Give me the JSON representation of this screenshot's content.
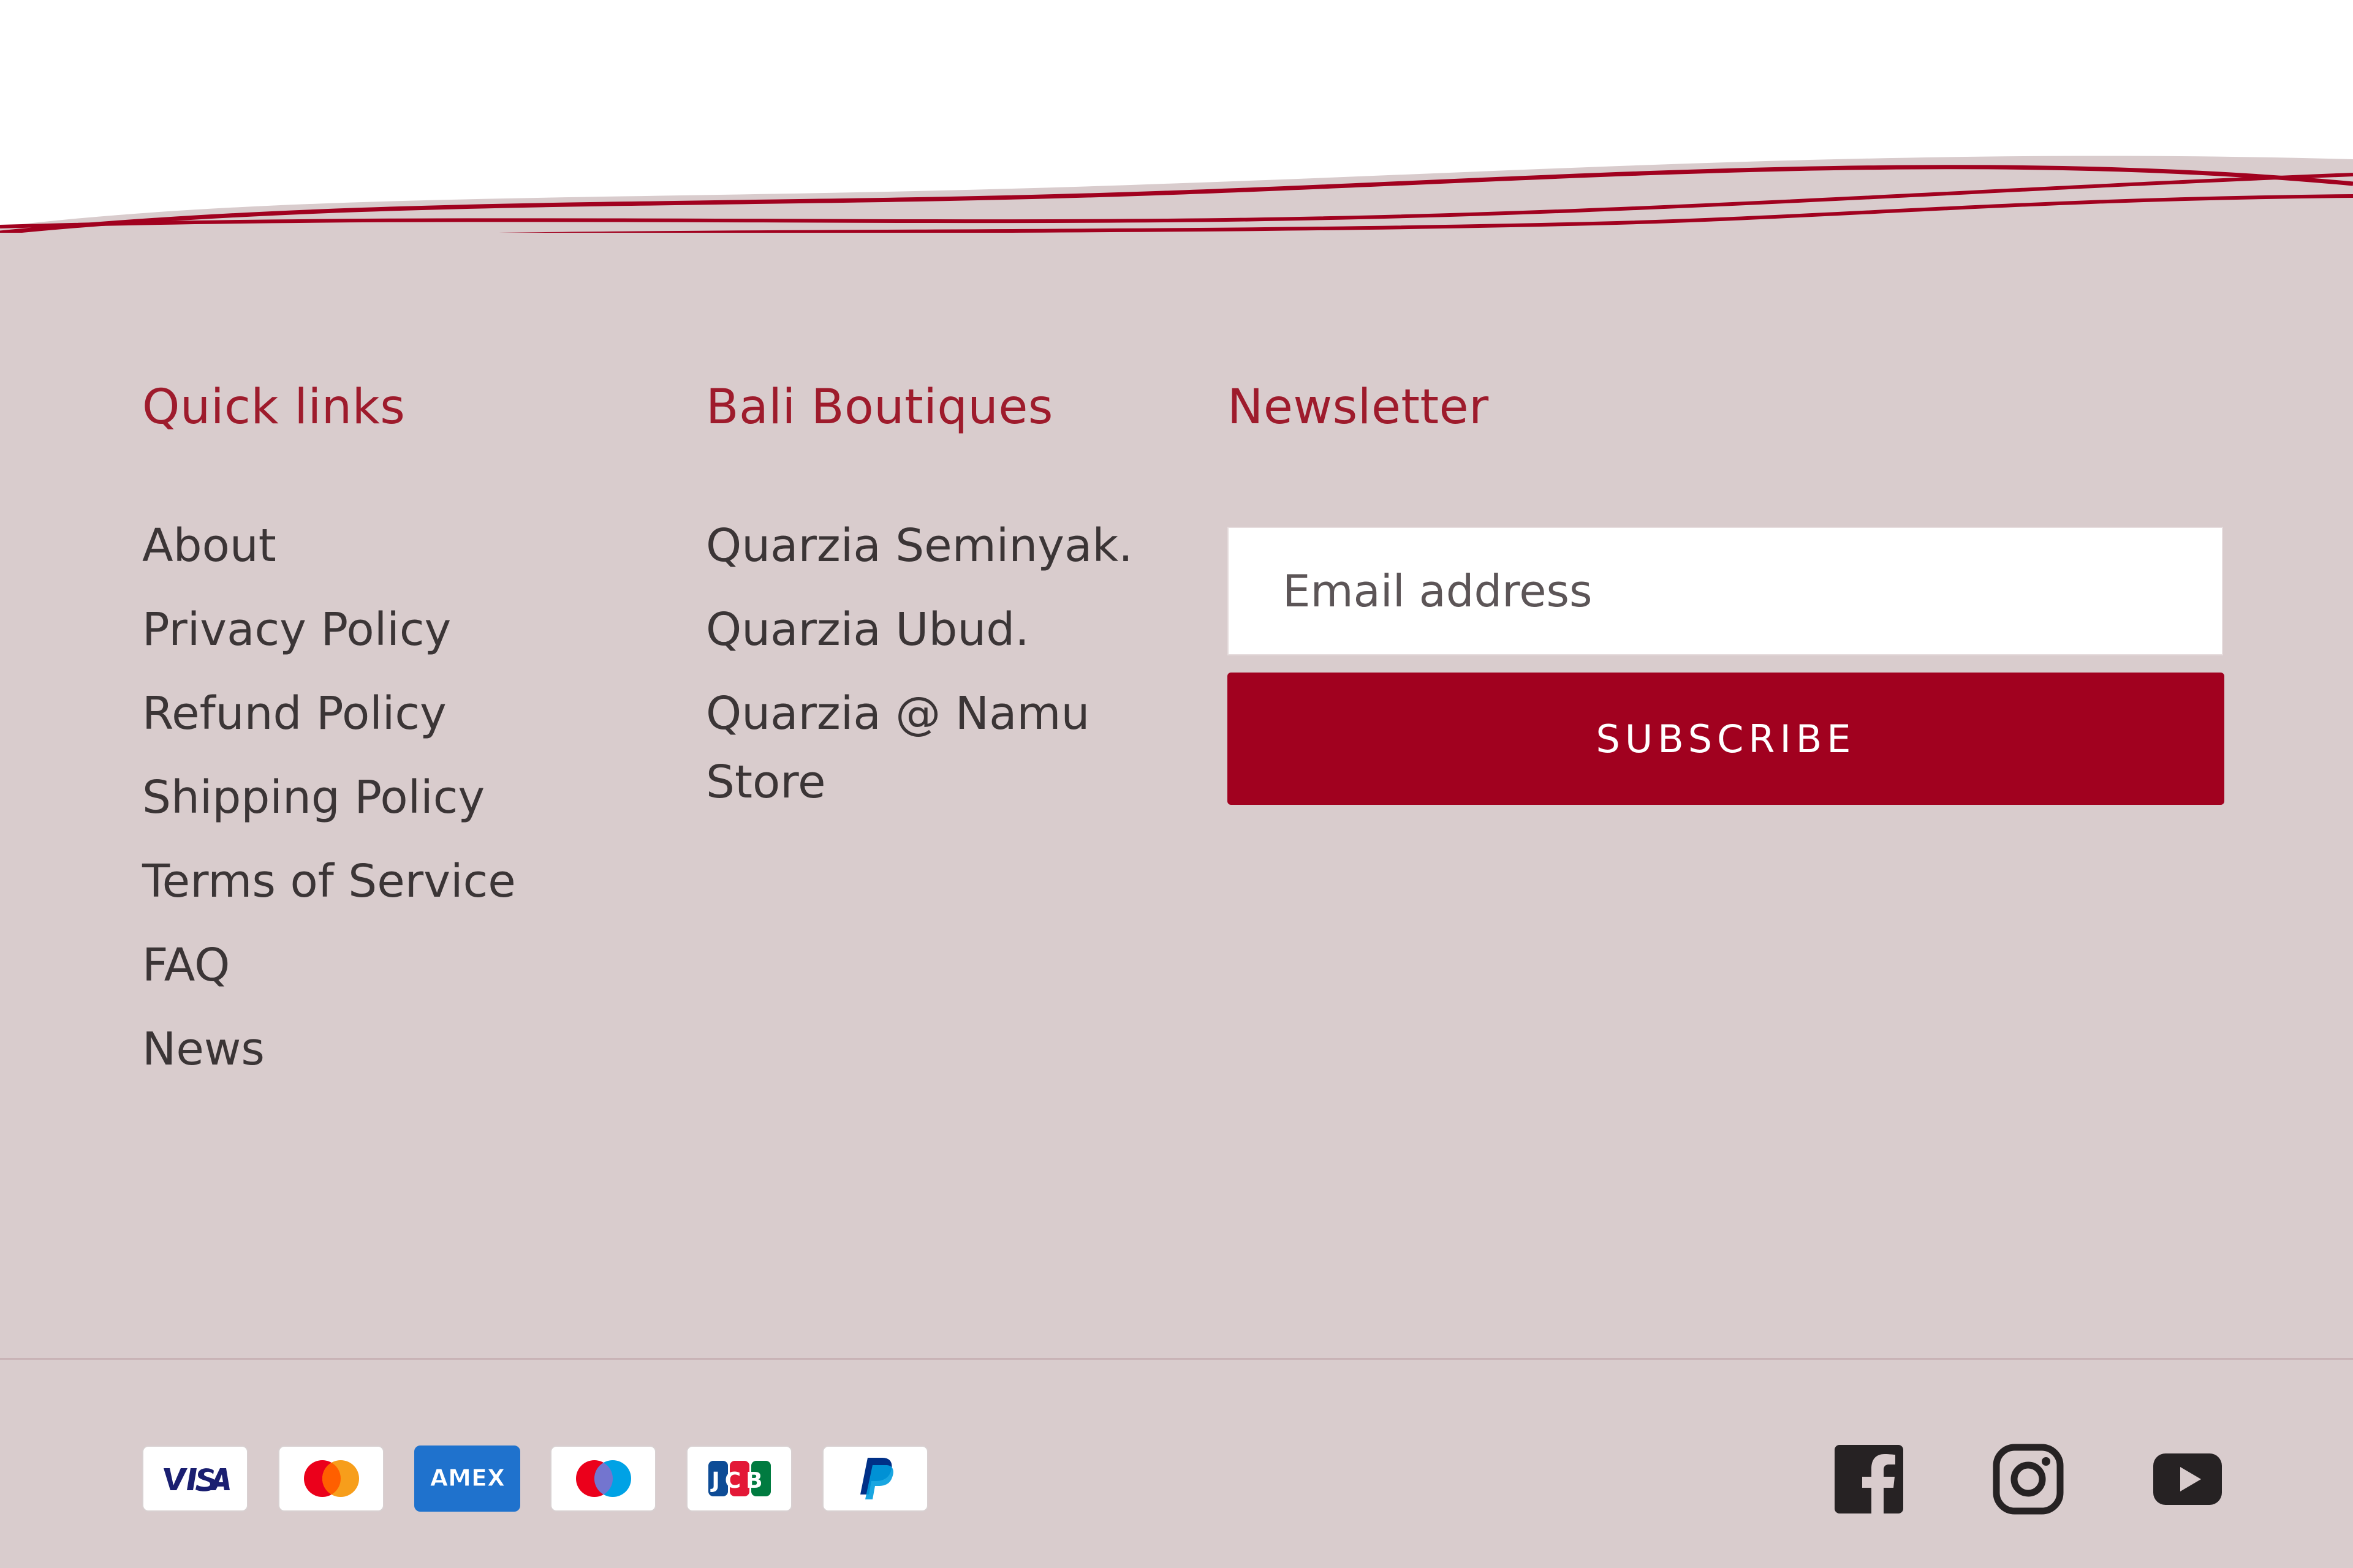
{
  "footer": {
    "quick_links": {
      "title": "Quick links",
      "items": [
        {
          "label": "About"
        },
        {
          "label": "Privacy Policy"
        },
        {
          "label": "Refund Policy"
        },
        {
          "label": "Shipping Policy"
        },
        {
          "label": "Terms of Service"
        },
        {
          "label": "FAQ"
        },
        {
          "label": "News"
        }
      ]
    },
    "bali_boutiques": {
      "title": "Bali Boutiques",
      "items": [
        {
          "label": "Quarzia Seminyak."
        },
        {
          "label": "Quarzia Ubud."
        },
        {
          "label": "Quarzia @ Namu Store"
        }
      ]
    },
    "newsletter": {
      "title": "Newsletter",
      "email_placeholder": "Email address",
      "email_value": "",
      "subscribe_label": "SUBSCRIBE"
    },
    "payment_methods": [
      {
        "name": "Visa",
        "icon": "visa-icon"
      },
      {
        "name": "Mastercard",
        "icon": "mastercard-icon"
      },
      {
        "name": "American Express",
        "icon": "amex-icon",
        "text": "AMEX"
      },
      {
        "name": "Maestro",
        "icon": "maestro-icon"
      },
      {
        "name": "JCB",
        "icon": "jcb-icon",
        "text": "JCB"
      },
      {
        "name": "PayPal",
        "icon": "paypal-icon"
      }
    ],
    "social": [
      {
        "name": "Facebook",
        "icon": "facebook-icon"
      },
      {
        "name": "Instagram",
        "icon": "instagram-icon"
      },
      {
        "name": "YouTube",
        "icon": "youtube-icon"
      }
    ]
  },
  "colors": {
    "accent": "#a1011f",
    "heading": "#9e1b2c",
    "footer_bg": "#d9cccd",
    "text": "#3b3536",
    "amex_blue": "#1f72cd"
  }
}
